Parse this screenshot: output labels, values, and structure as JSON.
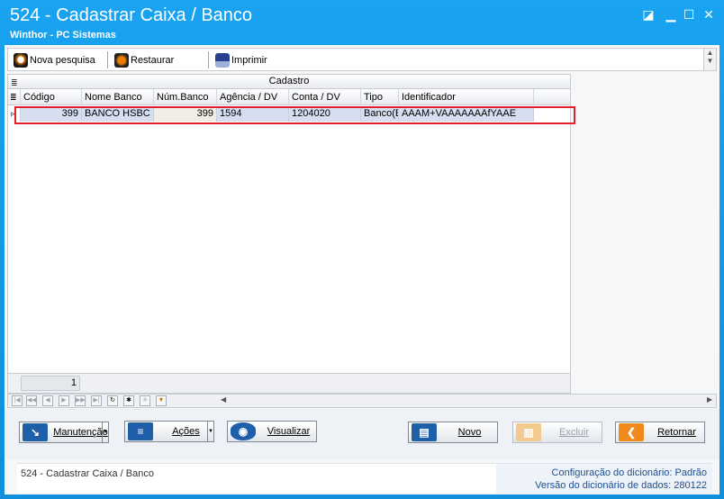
{
  "window": {
    "title": "524 - Cadastrar Caixa / Banco",
    "subtitle": "Winthor - PC Sistemas"
  },
  "toolbar": {
    "nova_pesquisa": "Nova pesquisa",
    "restaurar": "Restaurar",
    "imprimir": "Imprimir"
  },
  "grid": {
    "band_title": "Cadastro",
    "columns": [
      "Código",
      "Nome Banco",
      "Núm.Banco",
      "Agência / DV",
      "Conta / DV",
      "Tipo",
      "Identificador"
    ],
    "rows": [
      {
        "codigo": "399",
        "nome_banco": "BANCO HSBC",
        "num_banco": "399",
        "agencia": "1594",
        "conta": "1204020",
        "tipo": "Banco(E",
        "identificador": "AAAM+VAAAAAAAfYAAE"
      }
    ],
    "footer_count": "1"
  },
  "buttons": {
    "manutencao": "Manutenção",
    "acoes": "Ações",
    "visualizar": "Visualizar",
    "novo": "Novo",
    "excluir": "Excluir",
    "retornar": "Retornar"
  },
  "status": {
    "left": "524 - Cadastrar Caixa / Banco",
    "config_label": "Configuração do dicionário:",
    "config_value": "Padrão",
    "version_label": "Versão do dicionário de dados:",
    "version_value": "280122"
  },
  "colors": {
    "titlebar": "#19a3f0",
    "selection_outline": "#e0202a",
    "selected_row": "#d5dff0",
    "retornar_accent": "#f08a1c"
  }
}
